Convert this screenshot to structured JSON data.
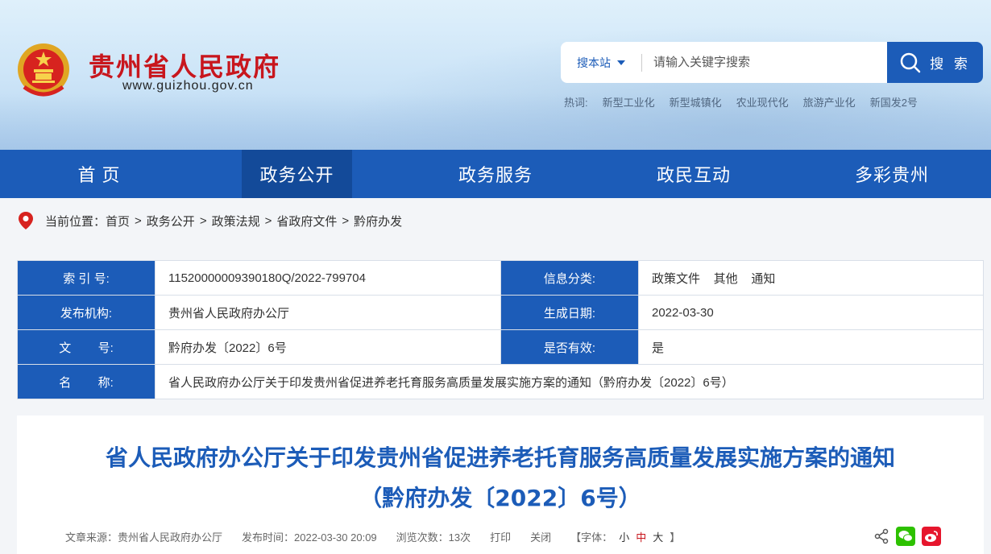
{
  "header": {
    "site_title": "贵州省人民政府",
    "site_url": "www.guizhou.gov.cn",
    "search": {
      "scope": "搜本站",
      "placeholder": "请输入关键字搜索",
      "button": "搜 索"
    },
    "hotwords_label": "热词:",
    "hotwords": [
      "新型工业化",
      "新型城镇化",
      "农业现代化",
      "旅游产业化",
      "新国发2号"
    ]
  },
  "nav": [
    "首 页",
    "政务公开",
    "政务服务",
    "政民互动",
    "多彩贵州"
  ],
  "breadcrumb": {
    "label": "当前位置：",
    "items": [
      "首页",
      "政务公开",
      "政策法规",
      "省政府文件",
      "黔府办发"
    ]
  },
  "info_table": {
    "index_label": "索 引 号:",
    "index_value": "11520000009390180Q/2022-799704",
    "category_label": "信息分类:",
    "category_value": "政策文件    其他    通知",
    "publisher_label": "发布机构:",
    "publisher_value": "贵州省人民政府办公厅",
    "date_label": "生成日期:",
    "date_value": "2022-03-30",
    "docno_label": "文        号:",
    "docno_value": "黔府办发〔2022〕6号",
    "valid_label": "是否有效:",
    "valid_value": "是",
    "name_label": "名        称:",
    "name_value": "省人民政府办公厅关于印发贵州省促进养老托育服务高质量发展实施方案的通知（黔府办发〔2022〕6号）"
  },
  "article": {
    "title_line1": "省人民政府办公厅关于印发贵州省促进养老托育服务高质量发展实施方案的通知",
    "title_line2": "（黔府办发〔2022〕6号）",
    "source": "文章来源：贵州省人民政府办公厅",
    "published": "发布时间：2022-03-30 20:09",
    "views": "浏览次数：13次",
    "print": "打印",
    "close": "关闭",
    "font_open": "【字体：",
    "font_small": "小",
    "font_medium": "中",
    "font_large": "大",
    "font_close": "】"
  },
  "colors": {
    "brand_blue": "#1c5cb8",
    "title_red": "#c8161d",
    "nav_active": "#134a99"
  }
}
